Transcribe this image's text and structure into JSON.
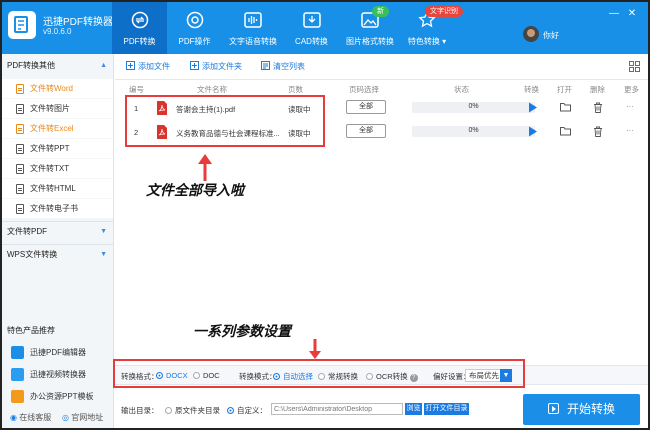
{
  "app": {
    "name": "迅捷PDF转换器",
    "version": "v9.0.6.0"
  },
  "nav": {
    "tabs": [
      {
        "label": "PDF转换",
        "icon": "convert-icon"
      },
      {
        "label": "PDF操作",
        "icon": "settings-circle-icon"
      },
      {
        "label": "文字语音转换",
        "icon": "audio-wave-icon"
      },
      {
        "label": "CAD转换",
        "icon": "cad-icon"
      },
      {
        "label": "图片格式转换",
        "icon": "image-icon"
      },
      {
        "label": "特色转换",
        "icon": "star-icon"
      }
    ],
    "badge_new": "新",
    "badge_text_recognition": "文字识别",
    "dropdown_arrow": "▾",
    "username": "你好"
  },
  "window": {
    "minimize": "—",
    "close": "✕"
  },
  "sidebar": {
    "group_pdf_to_other": "PDF转换其他",
    "items": [
      {
        "label": "文件转Word"
      },
      {
        "label": "文件转图片"
      },
      {
        "label": "文件转Excel"
      },
      {
        "label": "文件转PPT"
      },
      {
        "label": "文件转TXT"
      },
      {
        "label": "文件转HTML"
      },
      {
        "label": "文件转电子书"
      }
    ],
    "group_to_pdf": "文件转PDF",
    "group_wps_to_pdf": "WPS文件转换",
    "featured_title": "特色产品推荐",
    "products": [
      {
        "label": "迅捷PDF编辑器",
        "color": "#1b8fe8"
      },
      {
        "label": "迅捷视频转换器",
        "color": "#2a9df0"
      },
      {
        "label": "办公资源PPT模板",
        "color": "#f29a1b"
      }
    ],
    "online_service": "在线客服",
    "website": "官网地址"
  },
  "toolbar": {
    "add_file": "添加文件",
    "add_folder": "添加文件夹",
    "clear_list": "清空列表"
  },
  "table": {
    "headers": {
      "no": "编号",
      "name": "文件名称",
      "pages": "页数",
      "range": "页码选择",
      "status": "状态",
      "convert": "转换",
      "open": "打开",
      "delete": "删除",
      "more": "更多"
    },
    "rows": [
      {
        "no": "1",
        "name": "答谢会主持(1).pdf",
        "pages": "读取中",
        "range": "全部",
        "progress": "0%",
        "progress_value": 0
      },
      {
        "no": "2",
        "name": "义务教育品德与社会课程标准...",
        "pages": "读取中",
        "range": "全部",
        "progress": "0%",
        "progress_value": 0
      }
    ]
  },
  "annotations": {
    "import_all": "文件全部导入啦",
    "params": "一系列参数设置"
  },
  "settings": {
    "format_label": "转换格式：",
    "format_docx": "DOCX",
    "format_doc": "DOC",
    "mode_label": "转换模式：",
    "mode_auto": "自动选择",
    "mode_normal": "常规转换",
    "mode_ocr": "OCR转换",
    "help": "?",
    "pref_label": "偏好设置：",
    "pref_value": "布局优先",
    "selected_format": "DOCX",
    "selected_mode": "自动选择"
  },
  "output": {
    "label": "输出目录：",
    "original_folder": "原文件夹目录",
    "custom": "自定义：",
    "path": "C:\\Users\\Administrator\\Desktop",
    "browse": "浏览",
    "open_folder": "打开文件目录",
    "start": "开始转换"
  },
  "colors": {
    "header": "#1890e8",
    "accent": "#1b7be0",
    "active_item": "#e9891c",
    "highlight": "#e83b3b"
  }
}
